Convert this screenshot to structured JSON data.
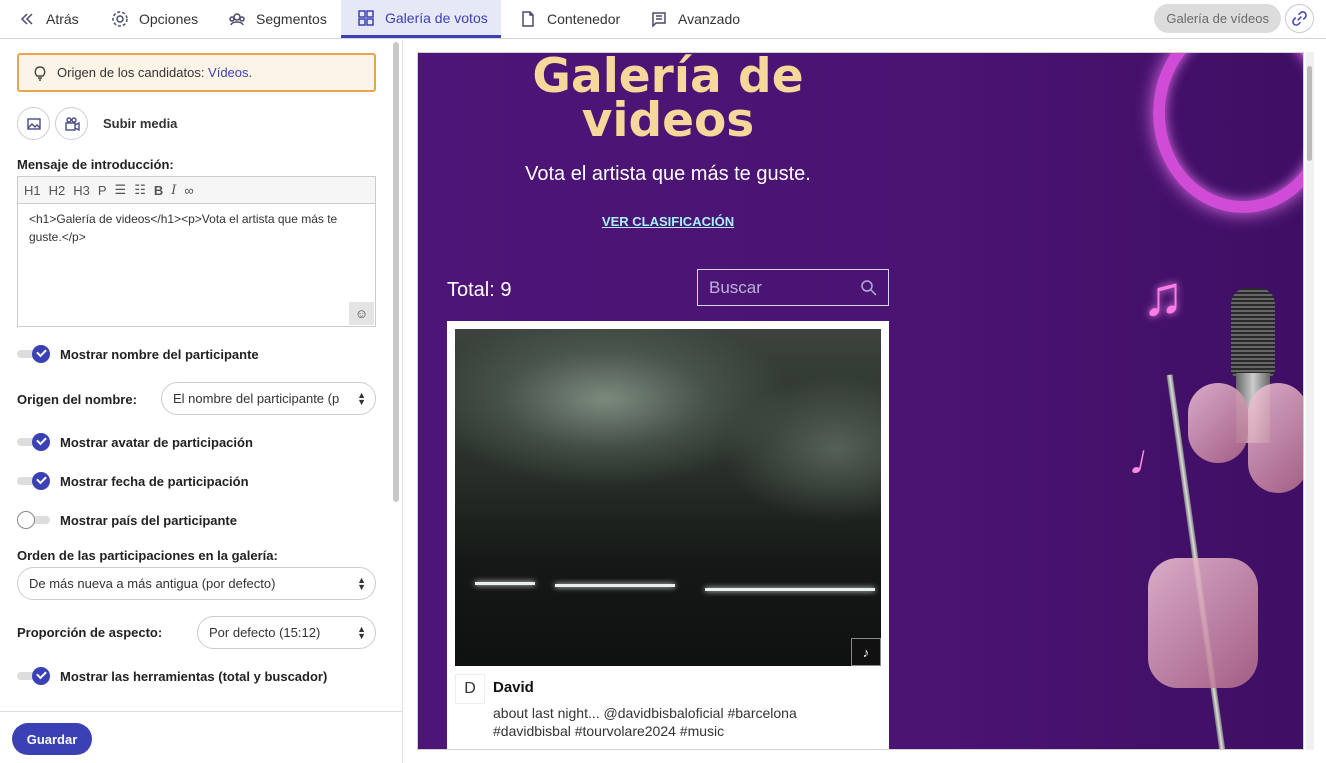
{
  "nav": {
    "back": "Atrás",
    "options": "Opciones",
    "segments": "Segmentos",
    "gallery": "Galería de votos",
    "container": "Contenedor",
    "advanced": "Avanzado",
    "title_pill": "Galería de vídeos"
  },
  "hint": {
    "prefix": "Origen de los candidatos: ",
    "value": "Vídeos",
    "suffix": "."
  },
  "media": {
    "upload_label": "Subir media"
  },
  "intro": {
    "label": "Mensaje de introducción:",
    "toolbar": [
      "H1",
      "H2",
      "H3",
      "P"
    ],
    "content": "<h1>Galería de videos</h1><p>Vota el artista que más te guste.</p>"
  },
  "settings": {
    "show_name": "Mostrar nombre del participante",
    "name_origin_label": "Origen del nombre:",
    "name_origin_value": "El nombre del participante (p",
    "show_avatar": "Mostrar avatar de participación",
    "show_date": "Mostrar fecha de participación",
    "show_country": "Mostrar país del participante",
    "order_label": "Orden de las participaciones en la galería:",
    "order_value": "De más nueva a más antigua (por defecto)",
    "aspect_label": "Proporción de aspecto:",
    "aspect_value": "Por defecto (15:12)",
    "show_tools": "Mostrar las herramientas (total y buscador)"
  },
  "save": "Guardar",
  "preview": {
    "title": "Galería de videos",
    "subtitle": "Vota el artista que más te guste.",
    "ranking_link": "VER CLASIFICACIÓN",
    "total": "Total: 9",
    "search_placeholder": "Buscar",
    "card": {
      "avatar_letter": "D",
      "name": "David",
      "description": "about last night... @davidbisbaloficial #barcelona #davidbisbal #tourvolare2024 #music"
    }
  },
  "colors": {
    "accent": "#3b40b4",
    "warning_border": "#e8a64a",
    "preview_bg": "#4c1577",
    "title_gold": "#f6d89a"
  }
}
